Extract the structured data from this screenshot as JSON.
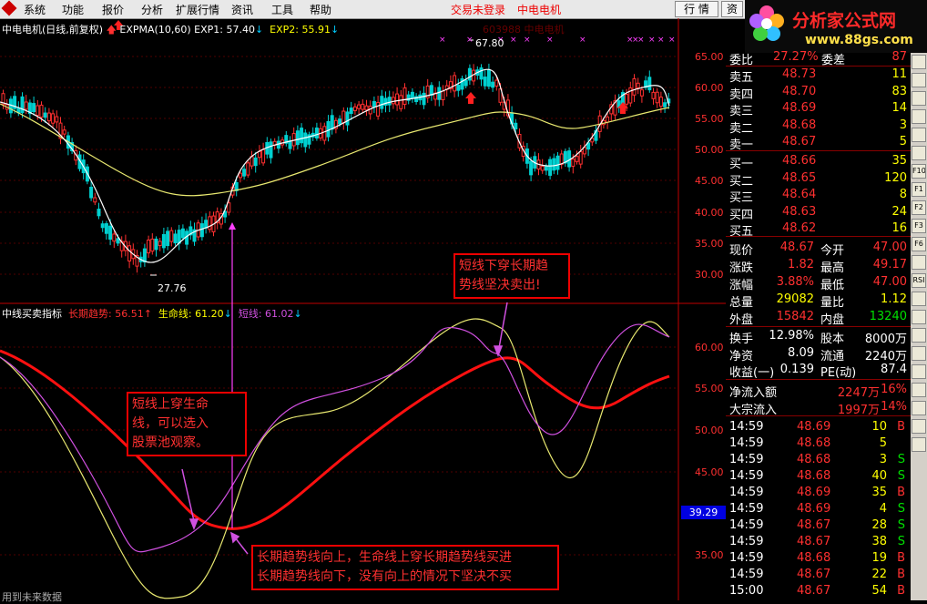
{
  "menu": {
    "items": [
      "系统",
      "功能",
      "报价",
      "分析",
      "扩展行情",
      "资讯",
      "工具",
      "帮助"
    ],
    "status_login": "交易未登录",
    "status_stock": "中电电机",
    "btn_quote": "行 情",
    "btn_info": "资"
  },
  "brand": {
    "title": "分析家公式网",
    "url": "www.88gs.com"
  },
  "main_header": {
    "name": "中电电机(日线,前复权)",
    "ind": "EXPMA(10,60)",
    "exp1": "EXP1: 57.40",
    "exp2": "EXP2: 55.91",
    "code_hint": "603988 中电电机"
  },
  "main_labels": {
    "high": "67.80",
    "low": "27.76"
  },
  "main_axis": [
    "65.00",
    "60.00",
    "55.00",
    "50.00",
    "45.00",
    "40.00",
    "35.00",
    "30.00"
  ],
  "sub_header": {
    "name": "中线买卖指标",
    "l1": "长期趋势: 56.51",
    "l2": "生命线: 61.20",
    "l3": "短线: 61.02"
  },
  "sub_axis": [
    "60.00",
    "55.00",
    "50.00",
    "45.00",
    "35.00"
  ],
  "crosshair_value": "39.29",
  "annotations": {
    "a1": [
      "短线上穿生命",
      "线，可以选入",
      "股票池观察。"
    ],
    "a2": [
      "短线下穿长期趋",
      "势线坚决卖出!"
    ],
    "a3": [
      "长期趋势线向上，生命线上穿长期趋势线买进",
      "长期趋势线向下，没有向上的情况下坚决不买"
    ]
  },
  "footer": "用到未来数据",
  "quote": {
    "weibi": {
      "label": "委比",
      "val": "27.27%",
      "label2": "委差",
      "val2": "87"
    },
    "asks": [
      {
        "l": "卖五",
        "p": "48.73",
        "v": "11"
      },
      {
        "l": "卖四",
        "p": "48.70",
        "v": "83"
      },
      {
        "l": "卖三",
        "p": "48.69",
        "v": "14"
      },
      {
        "l": "卖二",
        "p": "48.68",
        "v": "3"
      },
      {
        "l": "卖一",
        "p": "48.67",
        "v": "5"
      }
    ],
    "bids": [
      {
        "l": "买一",
        "p": "48.66",
        "v": "35"
      },
      {
        "l": "买二",
        "p": "48.65",
        "v": "120"
      },
      {
        "l": "买三",
        "p": "48.64",
        "v": "8"
      },
      {
        "l": "买四",
        "p": "48.63",
        "v": "24"
      },
      {
        "l": "买五",
        "p": "48.62",
        "v": "16"
      }
    ],
    "stats": [
      {
        "l": "现价",
        "v": "48.67",
        "c": "red",
        "l2": "今开",
        "v2": "47.00",
        "c2": "red"
      },
      {
        "l": "涨跌",
        "v": "1.82",
        "c": "red",
        "l2": "最高",
        "v2": "49.17",
        "c2": "red"
      },
      {
        "l": "涨幅",
        "v": "3.88%",
        "c": "red",
        "l2": "最低",
        "v2": "47.00",
        "c2": "red"
      },
      {
        "l": "总量",
        "v": "29082",
        "c": "yel",
        "l2": "量比",
        "v2": "1.12",
        "c2": "yel"
      },
      {
        "l": "外盘",
        "v": "15842",
        "c": "red",
        "l2": "内盘",
        "v2": "13240",
        "c2": "green"
      }
    ],
    "stats2": [
      {
        "l": "换手",
        "v": "12.98%",
        "l2": "股本",
        "v2": "8000万"
      },
      {
        "l": "净资",
        "v": "8.09",
        "l2": "流通",
        "v2": "2240万"
      },
      {
        "l": "收益(一)",
        "v": "0.139",
        "l2": "PE(动)",
        "v2": "87.4"
      }
    ],
    "flows": [
      {
        "l": "净流入额",
        "v": "2247万",
        "p": "16%"
      },
      {
        "l": "大宗流入",
        "v": "1997万",
        "p": "14%"
      }
    ],
    "ticks": [
      {
        "t": "14:59",
        "p": "48.69",
        "v": "10",
        "d": "B"
      },
      {
        "t": "14:59",
        "p": "48.68",
        "v": "5",
        "d": ""
      },
      {
        "t": "14:59",
        "p": "48.68",
        "v": "3",
        "d": "S"
      },
      {
        "t": "14:59",
        "p": "48.68",
        "v": "40",
        "d": "S"
      },
      {
        "t": "14:59",
        "p": "48.69",
        "v": "35",
        "d": "B"
      },
      {
        "t": "14:59",
        "p": "48.69",
        "v": "4",
        "d": "S"
      },
      {
        "t": "14:59",
        "p": "48.67",
        "v": "28",
        "d": "S"
      },
      {
        "t": "14:59",
        "p": "48.67",
        "v": "38",
        "d": "S"
      },
      {
        "t": "14:59",
        "p": "48.68",
        "v": "19",
        "d": "B"
      },
      {
        "t": "14:59",
        "p": "48.67",
        "v": "22",
        "d": "B"
      },
      {
        "t": "15:00",
        "p": "48.67",
        "v": "54",
        "d": "B"
      }
    ]
  },
  "toolstrip": [
    "",
    "",
    "",
    "",
    "",
    "",
    "F10",
    "F1",
    "F2",
    "F3",
    "F6",
    "",
    "RSI",
    "",
    "",
    "",
    "",
    "",
    "",
    "",
    "",
    ""
  ],
  "colors": {
    "up": "#ff3030",
    "down": "#00d0d0",
    "exp1": "#ffffff",
    "exp2": "#e8e870",
    "trend": "#ff1010",
    "life": "#e8e870",
    "short": "#d050e0",
    "axis": "#c00000",
    "buy_line": "#ff40ff"
  }
}
